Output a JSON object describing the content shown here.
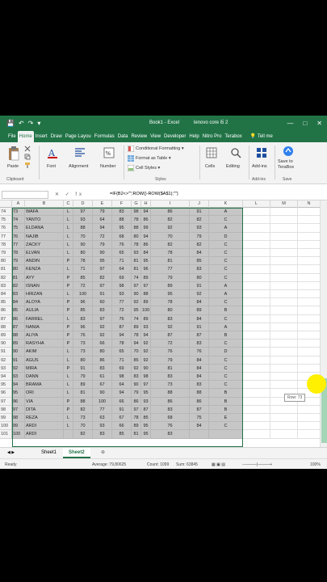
{
  "title": {
    "doc": "Book1 - Excel",
    "user": "lenovo core i5 2",
    "window_controls": [
      "—",
      "□",
      "✕"
    ],
    "qa_icons": [
      "💾",
      "↶",
      "↷",
      "▾"
    ]
  },
  "tabs": [
    "File",
    "Home",
    "Insert",
    "Draw",
    "Page Layou",
    "Formulas",
    "Data",
    "Review",
    "View",
    "Developer",
    "Help",
    "Nitro Pro",
    "Terabox"
  ],
  "tell_me": "Tell me",
  "ribbon": {
    "paste": "Paste",
    "clipboard": "Clipboard",
    "font": "Font",
    "alignment": "Alignment",
    "number": "Number",
    "cond_format": "Conditional Formatting ▾",
    "format_table": "Format as Table ▾",
    "cell_styles": "Cell Styles ▾",
    "styles": "Styles",
    "cells": "Cells",
    "editing": "Editing",
    "addins": "Add-ins",
    "addins_group": "Add-ins",
    "save_terabox": "Save to",
    "save_terabox2": "TeraBox",
    "save_group": "Save"
  },
  "formula_bar": {
    "fx": "✕ ✓ fx",
    "formula": "=IF(B2<>\"\";ROW()-ROW($A$1);\"\")"
  },
  "columns": [
    "A",
    "B",
    "C",
    "D",
    "E",
    "F",
    "G",
    "H",
    "I",
    "J",
    "K",
    "L",
    "M",
    "N"
  ],
  "rows": [
    {
      "n": "74",
      "a": "73",
      "b": "WAFA",
      "c": "L",
      "d": "97",
      "e": "79",
      "f": "83",
      "g": "98",
      "h": "94",
      "i": "86",
      "j": "91",
      "k": "A"
    },
    {
      "n": "75",
      "a": "74",
      "b": "YANTO",
      "c": "L",
      "d": "93",
      "e": "64",
      "f": "88",
      "g": "78",
      "h": "86",
      "i": "82",
      "j": "82",
      "k": "C"
    },
    {
      "n": "76",
      "a": "75",
      "b": "ELDANA",
      "c": "L",
      "d": "88",
      "e": "94",
      "f": "95",
      "g": "88",
      "h": "99",
      "i": "92",
      "j": "93",
      "k": "A"
    },
    {
      "n": "77",
      "a": "76",
      "b": "NAJIB",
      "c": "L",
      "d": "70",
      "e": "72",
      "f": "68",
      "g": "80",
      "h": "94",
      "i": "70",
      "j": "79",
      "k": "D"
    },
    {
      "n": "78",
      "a": "77",
      "b": "ZACKY",
      "c": "L",
      "d": "90",
      "e": "79",
      "f": "76",
      "g": "78",
      "h": "86",
      "i": "82",
      "j": "82",
      "k": "C"
    },
    {
      "n": "79",
      "a": "78",
      "b": "ELVAN",
      "c": "L",
      "d": "80",
      "e": "90",
      "f": "65",
      "g": "93",
      "h": "84",
      "i": "78",
      "j": "84",
      "k": "C"
    },
    {
      "n": "80",
      "a": "79",
      "b": "ANDIN",
      "c": "P",
      "d": "78",
      "e": "95",
      "f": "71",
      "g": "81",
      "h": "95",
      "i": "81",
      "j": "85",
      "k": "C"
    },
    {
      "n": "81",
      "a": "80",
      "b": "KENZA",
      "c": "L",
      "d": "71",
      "e": "97",
      "f": "64",
      "g": "81",
      "h": "96",
      "i": "77",
      "j": "83",
      "k": "C"
    },
    {
      "n": "82",
      "a": "81",
      "b": "AYY",
      "c": "P",
      "d": "85",
      "e": "82",
      "f": "69",
      "g": "74",
      "h": "89",
      "i": "79",
      "j": "80",
      "k": "C"
    },
    {
      "n": "83",
      "a": "82",
      "b": "ISNAN",
      "c": "P",
      "d": "72",
      "e": "97",
      "f": "98",
      "g": "97",
      "h": "97",
      "i": "89",
      "j": "91",
      "k": "A"
    },
    {
      "n": "84",
      "a": "83",
      "b": "HIRZAN",
      "c": "L",
      "d": "100",
      "e": "91",
      "f": "93",
      "g": "90",
      "h": "88",
      "i": "95",
      "j": "92",
      "k": "A"
    },
    {
      "n": "85",
      "a": "84",
      "b": "ALOYA",
      "c": "P",
      "d": "96",
      "e": "60",
      "f": "77",
      "g": "92",
      "h": "89",
      "i": "78",
      "j": "84",
      "k": "C"
    },
    {
      "n": "86",
      "a": "85",
      "b": "AULIA",
      "c": "P",
      "d": "85",
      "e": "83",
      "f": "72",
      "g": "95",
      "h": "100",
      "i": "80",
      "j": "89",
      "k": "B"
    },
    {
      "n": "87",
      "a": "86",
      "b": "FARREL",
      "c": "L",
      "d": "83",
      "e": "97",
      "f": "76",
      "g": "74",
      "h": "89",
      "i": "83",
      "j": "84",
      "k": "C"
    },
    {
      "n": "88",
      "a": "87",
      "b": "NANIA",
      "c": "P",
      "d": "96",
      "e": "92",
      "f": "87",
      "g": "89",
      "h": "93",
      "i": "92",
      "j": "91",
      "k": "A"
    },
    {
      "n": "89",
      "a": "88",
      "b": "ALIYA",
      "c": "P",
      "d": "76",
      "e": "92",
      "f": "94",
      "g": "78",
      "h": "94",
      "i": "87",
      "j": "87",
      "k": "B"
    },
    {
      "n": "90",
      "a": "89",
      "b": "RASYHA",
      "c": "P",
      "d": "73",
      "e": "66",
      "f": "78",
      "g": "94",
      "h": "92",
      "i": "72",
      "j": "83",
      "k": "C"
    },
    {
      "n": "91",
      "a": "90",
      "b": "AKIM",
      "c": "L",
      "d": "73",
      "e": "80",
      "f": "65",
      "g": "70",
      "h": "92",
      "i": "76",
      "j": "76",
      "k": "D"
    },
    {
      "n": "92",
      "a": "91",
      "b": "AGUS",
      "c": "L",
      "d": "80",
      "e": "86",
      "f": "71",
      "g": "85",
      "h": "92",
      "i": "79",
      "j": "84",
      "k": "C"
    },
    {
      "n": "93",
      "a": "92",
      "b": "MIRA",
      "c": "P",
      "d": "91",
      "e": "83",
      "f": "69",
      "g": "92",
      "h": "90",
      "i": "81",
      "j": "84",
      "k": "C"
    },
    {
      "n": "94",
      "a": "93",
      "b": "DANN",
      "c": "L",
      "d": "79",
      "e": "61",
      "f": "98",
      "g": "83",
      "h": "98",
      "i": "83",
      "j": "84",
      "k": "C"
    },
    {
      "n": "95",
      "a": "94",
      "b": "BRAMA",
      "c": "L",
      "d": "89",
      "e": "67",
      "f": "64",
      "g": "90",
      "h": "97",
      "i": "73",
      "j": "83",
      "k": "C"
    },
    {
      "n": "96",
      "a": "95",
      "b": "ORI",
      "c": "L",
      "d": "81",
      "e": "90",
      "f": "94",
      "g": "79",
      "h": "95",
      "i": "88",
      "j": "88",
      "k": "B"
    },
    {
      "n": "97",
      "a": "96",
      "b": "VIA",
      "c": "P",
      "d": "88",
      "e": "100",
      "f": "66",
      "g": "86",
      "h": "93",
      "i": "86",
      "j": "86",
      "k": "B"
    },
    {
      "n": "98",
      "a": "97",
      "b": "DITA",
      "c": "P",
      "d": "82",
      "e": "77",
      "f": "91",
      "g": "97",
      "h": "87",
      "i": "83",
      "j": "87",
      "k": "B"
    },
    {
      "n": "99",
      "a": "98",
      "b": "REZA",
      "c": "L",
      "d": "73",
      "e": "63",
      "f": "67",
      "g": "78",
      "h": "85",
      "i": "68",
      "j": "75",
      "k": "E"
    },
    {
      "n": "100",
      "a": "99",
      "b": "ARDI",
      "c": "L",
      "d": "70",
      "e": "93",
      "f": "66",
      "g": "89",
      "h": "95",
      "i": "76",
      "j": "84",
      "k": "C"
    },
    {
      "n": "101",
      "a": "100",
      "b": "ARDI",
      "c": "",
      "d": "82",
      "e": "83",
      "f": "85",
      "g": "81",
      "h": "95",
      "i": "83",
      "j": "",
      "k": ""
    }
  ],
  "tooltip": "Row: 73",
  "sheets": [
    "Sheet1",
    "Sheet2"
  ],
  "add_sheet": "⊕",
  "status": {
    "ready": "Ready",
    "average": "Average: 79,80625",
    "count": "Count: 1099",
    "sum": "Sum: 63845",
    "zoom": "100%"
  },
  "colors": {
    "accent": "#217346",
    "selection": "#c6c6c6",
    "cursor": "#ffef00"
  }
}
